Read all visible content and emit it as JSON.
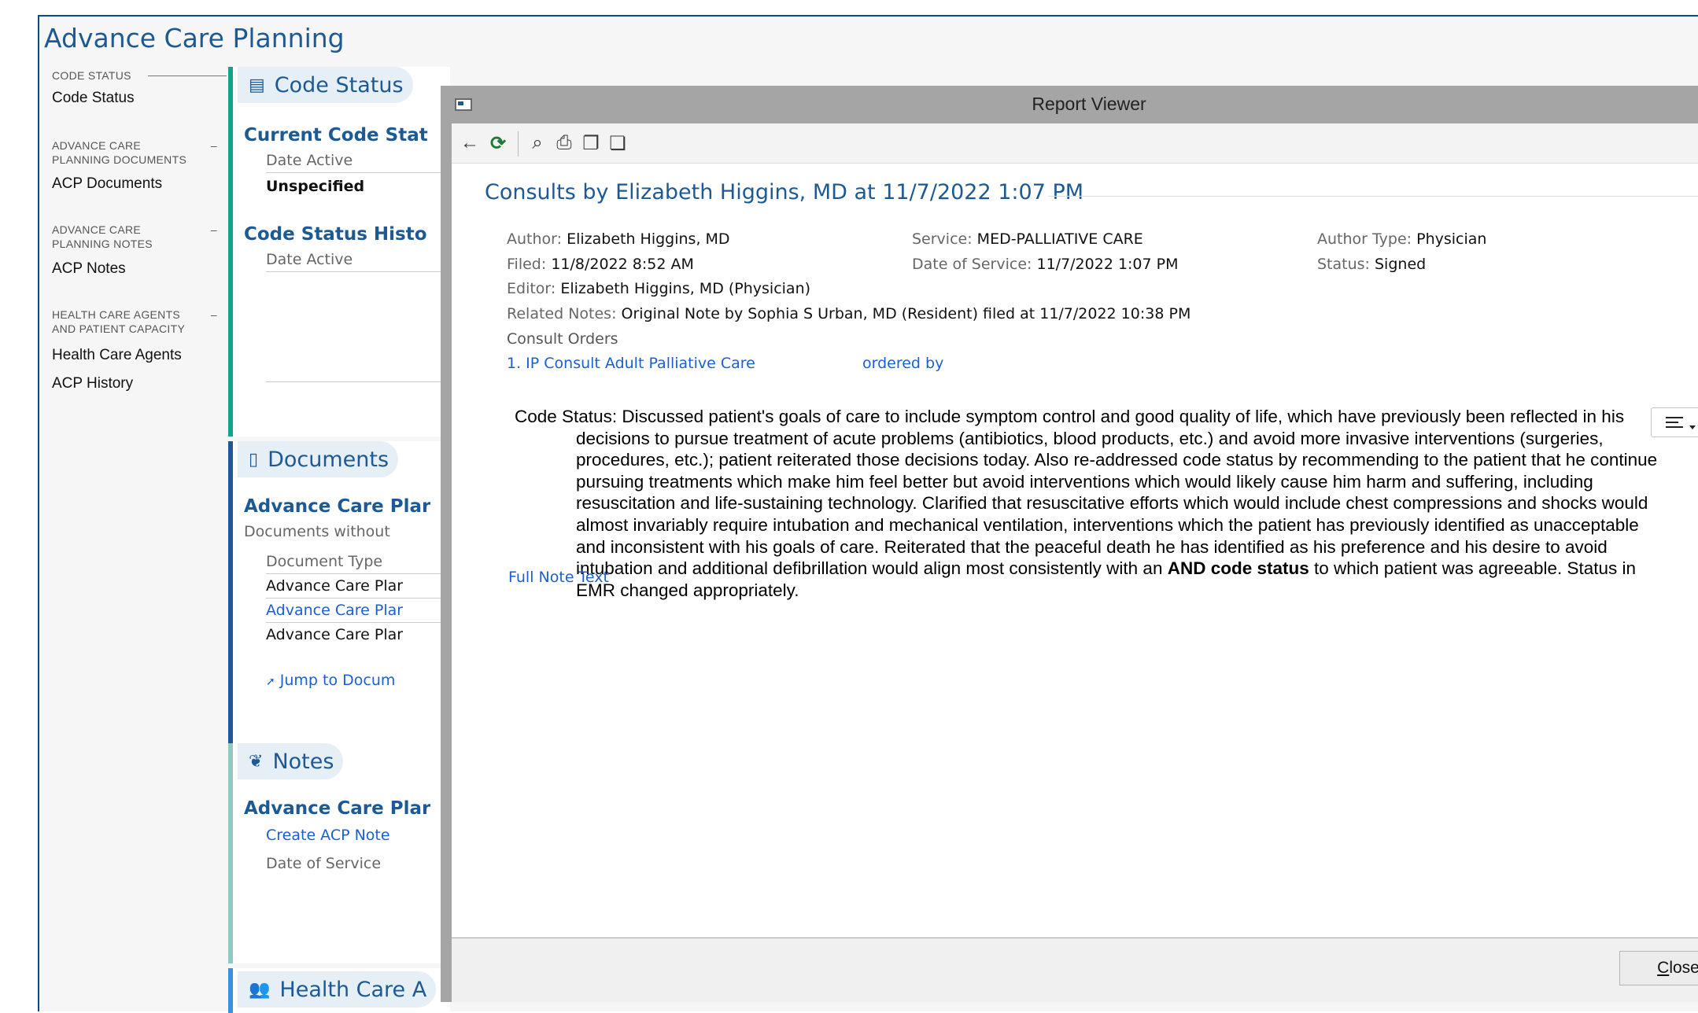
{
  "app": {
    "title": "Advance Care Planning"
  },
  "nav": {
    "sections": [
      {
        "header_line1": "Code Status",
        "header_line2": "",
        "items": [
          "Code Status"
        ]
      },
      {
        "header_line1": "Advance Care",
        "header_line2": "Planning Documents",
        "items": [
          "ACP Documents"
        ]
      },
      {
        "header_line1": "Advance Care",
        "header_line2": "Planning Notes",
        "items": [
          "ACP Notes"
        ]
      },
      {
        "header_line1": "Health Care Agents",
        "header_line2": "and Patient Capacity",
        "items": [
          "Health Care Agents",
          "ACP History"
        ]
      }
    ],
    "collapse_glyph": "–"
  },
  "code_status": {
    "title": "Code Status",
    "current_heading": "Current Code Stat",
    "date_active_label": "Date Active",
    "current_value": "Unspecified",
    "history_heading": "Code Status Histo",
    "history_date_label": "Date Active"
  },
  "documents": {
    "title": "Documents",
    "heading": "Advance Care Plar",
    "subtitle": "Documents without",
    "col_label": "Document Type",
    "rows": [
      "Advance Care Plar",
      "Advance Care Plar",
      "Advance Care Plar"
    ],
    "jump_link": "Jump to Docum"
  },
  "notes": {
    "title": "Notes",
    "heading": "Advance Care Plar",
    "create_link": "Create ACP Note",
    "date_label": "Date of Service"
  },
  "agents": {
    "title": "Health Care A"
  },
  "dialog": {
    "title": "Report Viewer",
    "close_glyph": "✕",
    "toolbar": {
      "back": "←",
      "refresh": "⟳",
      "find": "⌕",
      "print": "⎙",
      "copy": "❐",
      "copy2": "❏"
    },
    "report_title": "Consults by Elizabeth Higgins, MD at 11/7/2022  1:07 PM",
    "meta": {
      "author_k": "Author:",
      "author_v": "Elizabeth Higgins, MD",
      "service_k": "Service:",
      "service_v": "MED-PALLIATIVE CARE",
      "author_type_k": "Author Type:",
      "author_type_v": "Physician",
      "filed_k": "Filed:",
      "filed_v": "11/8/2022  8:52 AM",
      "dos_k": "Date of Service:",
      "dos_v": "11/7/2022  1:07 PM",
      "status_k": "Status:",
      "status_v": "Signed",
      "editor_k": "Editor:",
      "editor_v": "Elizabeth Higgins, MD (Physician)",
      "related_k": "Related Notes:",
      "related_v": "Original Note by Sophia S Urban, MD (Resident) filed at 11/7/2022 10:38 PM"
    },
    "consult_orders_label": "Consult Orders",
    "order_link": "1. IP Consult Adult Palliative Care",
    "ordered_by": "ordered by",
    "note_before": "Code Status: Discussed patient's goals of care to include symptom control and good quality of life, which have previously been reflected in his decisions to pursue treatment of acute problems (antibiotics, blood products, etc.) and avoid more invasive interventions (surgeries, procedures, etc.); patient reiterated those decisions today. Also re-addressed code status by recommending to the patient that he continue pursuing treatments which make him feel better but avoid interventions which would likely cause him harm and suffering, including resuscitation and life-sustaining technology. Clarified that resuscitative efforts which would include chest compressions and shocks would almost invariably require intubation and mechanical ventilation, interventions which the patient has previously identified as unacceptable and inconsistent with his goals of care. Reiterated that the peaceful death he has identified as his preference and his desire to avoid intubation and additional defibrillation would align most consistently with an ",
    "note_bold": "AND code status",
    "note_after": " to which patient was agreeable. Status in EMR changed appropriately.",
    "full_note_link": "Full Note Text",
    "close_mnemonic": "C",
    "close_rest": "lose"
  }
}
